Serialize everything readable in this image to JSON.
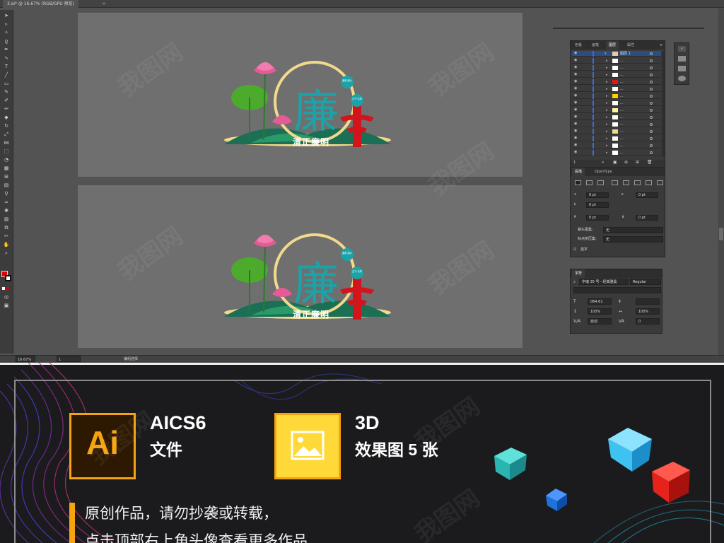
{
  "window": {
    "doc_tab": "3.ai* @ 16.67% (RGB/GPU 预览)",
    "doc_tab_close": "×"
  },
  "toolbar": {
    "tools": [
      "selection-tool",
      "direct-selection-tool",
      "magic-wand-tool",
      "lasso-tool",
      "pen-tool",
      "curvature-tool",
      "type-tool",
      "line-tool",
      "rectangle-tool",
      "paintbrush-tool",
      "shaper-tool",
      "pencil-tool",
      "eraser-tool",
      "rotate-tool",
      "scale-tool",
      "width-tool",
      "free-transform-tool",
      "shape-builder-tool",
      "perspective-grid-tool",
      "mesh-tool",
      "gradient-tool",
      "eyedropper-tool",
      "blend-tool",
      "symbol-sprayer-tool",
      "column-graph-tool",
      "artboard-tool",
      "slice-tool",
      "hand-tool",
      "zoom-tool"
    ],
    "fill_color": "#e40000",
    "stroke_color": "#ffffff"
  },
  "artwork": {
    "title": "清正廉明",
    "main_char": "廉",
    "badge_top": "廉政 廉公",
    "badge_mid": "正气 清风",
    "colors": {
      "teal": "#1aa3a8",
      "red": "#d3141c",
      "green": "#4caa2d",
      "pink": "#e55b96",
      "yellow": "#f2d98b",
      "darkgreen": "#1b6f55"
    }
  },
  "statusbar": {
    "zoom": "16.67%",
    "page": "1",
    "tool_name": "编组选择"
  },
  "layers_panel": {
    "tabs": [
      "色板",
      "画笔",
      "图层",
      "属性"
    ],
    "active_tab": "图层",
    "top_layer": "图层 1",
    "sublayer_dots": "...",
    "layer_thumbs": [
      "#ffffff",
      "#ffffff",
      "#ffffff",
      "#e8141c",
      "#ffffff",
      "#ffcc00",
      "#ffffff",
      "#fff3a0",
      "#ffffff",
      "#ffffff",
      "#f2d98b",
      "#ffffff",
      "#ffffff",
      "#ffffff"
    ]
  },
  "paragraph_panel": {
    "tabs": [
      "段落",
      "OpenType"
    ],
    "active_tab": "段落",
    "indent_left": "0 pt",
    "indent_right": "0 pt",
    "first_line": "0 pt",
    "space_before": "0 pt",
    "space_after": "0 pt",
    "space_extra": "0 pt",
    "kinsoku_label": "避头尾集:",
    "kinsoku_value": "无",
    "mojikumi_label": "标点挤压集:",
    "mojikumi_value": "无",
    "hyphenate": "连字"
  },
  "character_panel": {
    "tab": "字符",
    "font": "字魂 35 号 - 经典雅黑",
    "style": "Regular",
    "size": "064.61",
    "leading": "",
    "vscale": "100%",
    "hscale": "100%",
    "kerning": "自动",
    "tracking": "0"
  },
  "banner": {
    "ai_badge": "Ai",
    "ai_title": "AICS6",
    "ai_sub": "文件",
    "img_title": "3D",
    "img_sub": "效果图 5 张",
    "notice_1": "原创作品，请勿抄袭或转载，",
    "notice_2": "点击顶部右上角头像查看更多作品",
    "watermark": "我图网",
    "accent": "#f5a30f",
    "cube_colors": [
      "#2ab5b3",
      "#1e73d9",
      "#3ec3f0",
      "#e5231b"
    ]
  }
}
